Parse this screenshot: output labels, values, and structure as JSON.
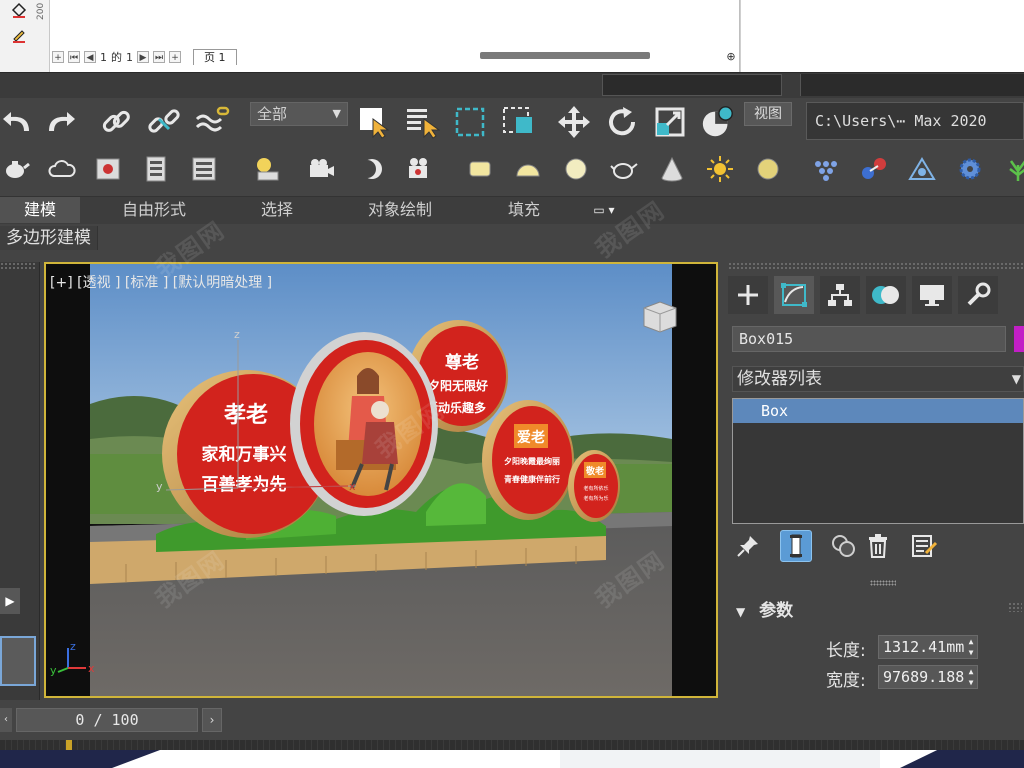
{
  "top_strip": {
    "ruler_number": "200",
    "pagination": {
      "current": "1",
      "of_label": "的",
      "total": "1"
    },
    "page_tab": "页 1"
  },
  "main_toolbar": {
    "selection_filter": "全部",
    "view_button": "视图",
    "project_path": "C:\\Users\\⋯ Max 2020"
  },
  "ribbon": {
    "tabs": [
      "建模",
      "自由形式",
      "选择",
      "对象绘制",
      "填充"
    ],
    "active_tab": "建模",
    "sub_panel": "多边形建模"
  },
  "viewport": {
    "label": "[+] [透视 ] [标准 ] [默认明暗处理 ]",
    "axis_labels": {
      "z": "z",
      "x": "x",
      "y": "y"
    },
    "signs": {
      "left": {
        "title": "孝老",
        "line1": "家和万事兴",
        "line2": "百善孝为先"
      },
      "top": {
        "title": "尊老",
        "line1": "夕阳无限好",
        "line2": "活动乐趣多"
      },
      "right": {
        "title": "爱老",
        "line1": "夕阳晚霞最绚丽",
        "line2": "青春健康伴前行"
      },
      "small": {
        "title": "敬老",
        "line1": "老有所依乐",
        "line2": "老有所为乐"
      }
    }
  },
  "command_panel": {
    "object_name": "Box015",
    "object_color": "#c21fc6",
    "modifier_list_label": "修改器列表",
    "stack_items": [
      "Box"
    ],
    "rollout_title": "参数",
    "params": [
      {
        "label": "长度:",
        "value": "1312.41mm"
      },
      {
        "label": "宽度:",
        "value": "97689.188"
      }
    ]
  },
  "time_slider": {
    "value": "0 / 100"
  },
  "watermark_text": "我图网",
  "colors": {
    "accent_yellow": "#d0b53a",
    "selection_blue": "#5d88bb",
    "ui_bg": "#444444"
  }
}
